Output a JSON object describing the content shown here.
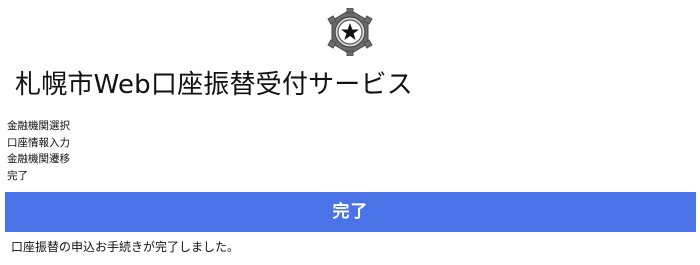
{
  "logo": {
    "icon": "sapporo-emblem-icon",
    "color": "#555555"
  },
  "title": "札幌市Web口座振替受付サービス",
  "steps": [
    {
      "label": "金融機関選択"
    },
    {
      "label": "口座情報入力"
    },
    {
      "label": "金融機関遷移"
    },
    {
      "label": "完了"
    }
  ],
  "banner": {
    "label": "完了",
    "color": "#4a73e8"
  },
  "message": "口座振替の申込お手続きが完了しました。"
}
